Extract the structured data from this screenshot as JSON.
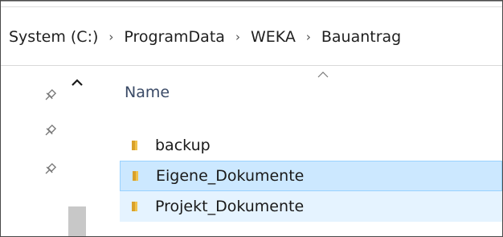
{
  "breadcrumb": {
    "items": [
      {
        "label": "System (C:)"
      },
      {
        "label": "ProgramData"
      },
      {
        "label": "WEKA"
      },
      {
        "label": "Bauantrag"
      }
    ],
    "separator": "›"
  },
  "nav": {
    "pins": [
      "pin-icon",
      "pin-icon",
      "pin-icon"
    ],
    "scroll_up_icon": "chevron-up-icon"
  },
  "list": {
    "sort_icon": "sort-ascending-icon",
    "column_header": "Name",
    "items": [
      {
        "label": "backup",
        "icon": "folder-icon",
        "state": "normal"
      },
      {
        "label": "Eigene_Dokumente",
        "icon": "folder-icon",
        "state": "selected"
      },
      {
        "label": "Projekt_Dokumente",
        "icon": "folder-icon",
        "state": "hover"
      }
    ]
  },
  "colors": {
    "selected_bg": "#cce8ff",
    "selected_border": "#99d1ff",
    "hover_bg": "#e5f3ff",
    "folder": "#e8b43a",
    "header_text": "#3a4a66"
  }
}
